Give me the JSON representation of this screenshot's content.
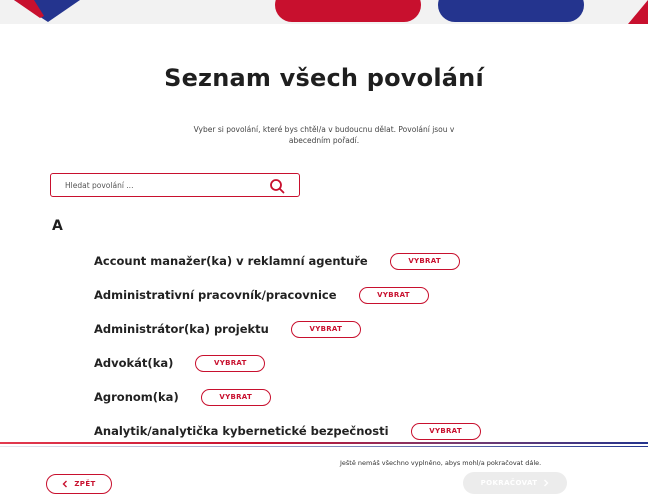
{
  "header": {
    "title": "Seznam všech povolání",
    "description": "Vyber si povolání, které bys chtěl/a v budoucnu dělat. Povolání jsou v abecedním pořadí."
  },
  "search": {
    "placeholder": "Hledat povolání ..."
  },
  "list": {
    "letter": "A",
    "select_label": "VYBRAT",
    "items": [
      {
        "name": "Account manažer(ka) v reklamní agentuře"
      },
      {
        "name": "Administrativní pracovník/pracovnice"
      },
      {
        "name": "Administrátor(ka) projektu"
      },
      {
        "name": "Advokát(ka)"
      },
      {
        "name": "Agronom(ka)"
      },
      {
        "name": "Analytik/analytička kybernetické bezpečnosti"
      }
    ]
  },
  "footer": {
    "message": "Ještě nemáš všechno vyplněno, abys mohl/a pokračovat dále.",
    "back_label": "ZPĚT",
    "continue_label": "POKRAČOVAT"
  },
  "colors": {
    "accent": "#c8102e",
    "navy": "#24348e",
    "disabled": "#ececec"
  },
  "icons": {
    "search": "search-icon",
    "back": "chevron-left-icon",
    "continue": "chevron-right-icon"
  }
}
